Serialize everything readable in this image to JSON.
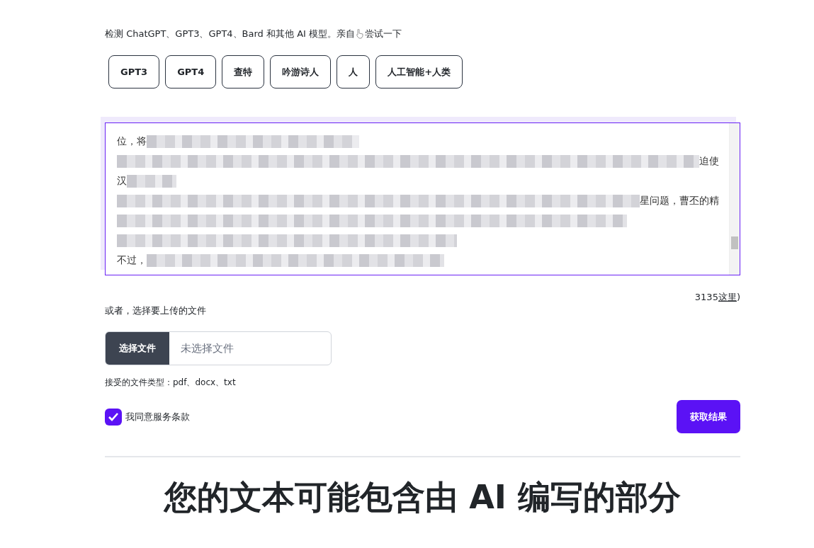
{
  "intro": {
    "before": "检测 ChatGPT、GPT3、GPT4、Bard 和其他 AI 模型。亲自",
    "after": "尝试一下"
  },
  "samples": [
    {
      "label": "GPT3"
    },
    {
      "label": "GPT4"
    },
    {
      "label": "查特"
    },
    {
      "label": "吟游诗人"
    },
    {
      "label": "人"
    },
    {
      "label": "人工智能+人类"
    }
  ],
  "text_area": {
    "lines": [
      {
        "kind": "start",
        "text": "位，将"
      },
      {
        "kind": "end",
        "text": "迫使"
      },
      {
        "kind": "start",
        "text": "汉"
      },
      {
        "kind": "end",
        "text": "星问题，曹丕的精"
      },
      {
        "kind": "blurred"
      },
      {
        "kind": "blurred"
      },
      {
        "kind": "start",
        "text": "不过，"
      }
    ]
  },
  "counter": {
    "count": "3135",
    "link": "这里",
    "close": ")"
  },
  "upload": {
    "label": "或者，选择要上传的文件",
    "button": "选择文件",
    "status": "未选择文件",
    "accepted": "接受的文件类型：pdf、docx、txt"
  },
  "terms": {
    "label": "我同意服务条款",
    "checked": true
  },
  "submit": "获取结果",
  "result_heading": "您的文本可能包含由 AI 编写的部分"
}
